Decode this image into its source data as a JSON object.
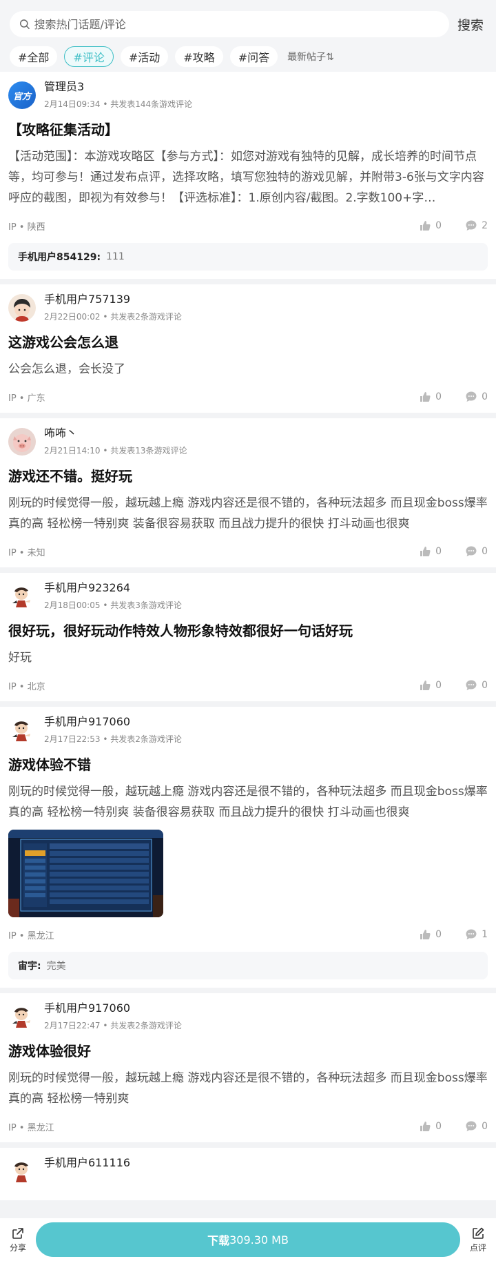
{
  "search": {
    "placeholder": "搜索热门话题/评论",
    "button_label": "搜索"
  },
  "filters": {
    "tags": [
      "#全部",
      "#评论",
      "#活动",
      "#攻略",
      "#问答"
    ],
    "active_index": 1,
    "sort_label": "最新帖子⇅"
  },
  "posts": [
    {
      "avatar": "官方",
      "username": "管理员3",
      "date": "2月14日09:34",
      "stats": "共发表144条游戏评论",
      "title": "【攻略征集活动】",
      "body": "【活动范围】：本游戏攻略区【参与方式】：如您对游戏有独特的见解，成长培养的时间节点等，均可参与！通过发布点评，选择攻略，填写您独特的游戏见解，并附带3-6张与文字内容呼应的截图，即视为有效参与！【评选标准】：1.原创内容/截图。2.字数100+字…",
      "ip": "IP • 陕西",
      "likes": "0",
      "comments": "2",
      "reply": {
        "user": "手机用户854129:",
        "text": "111"
      }
    },
    {
      "username": "手机用户757139",
      "date": "2月22日00:02",
      "stats": "共发表2条游戏评论",
      "title": "这游戏公会怎么退",
      "body": "公会怎么退，会长没了",
      "ip": "IP • 广东",
      "likes": "0",
      "comments": "0"
    },
    {
      "username": "咘咘丶",
      "date": "2月21日14:10",
      "stats": "共发表13条游戏评论",
      "title": "游戏还不错。挺好玩",
      "body": "刚玩的时候觉得一般，越玩越上瘾 游戏内容还是很不错的，各种玩法超多 而且现金boss爆率真的高 轻松榜一特别爽 装备很容易获取 而且战力提升的很快 打斗动画也很爽",
      "ip": "IP • 未知",
      "likes": "0",
      "comments": "0"
    },
    {
      "username": "手机用户923264",
      "date": "2月18日00:05",
      "stats": "共发表3条游戏评论",
      "title": "很好玩，很好玩动作特效人物形象特效都很好一句话好玩",
      "body": "好玩",
      "ip": "IP • 北京",
      "likes": "0",
      "comments": "0"
    },
    {
      "username": "手机用户917060",
      "date": "2月17日22:53",
      "stats": "共发表2条游戏评论",
      "title": "游戏体验不错",
      "body": "刚玩的时候觉得一般，越玩越上瘾 游戏内容还是很不错的，各种玩法超多 而且现金boss爆率真的高 轻松榜一特别爽 装备很容易获取 而且战力提升的很快 打斗动画也很爽",
      "ip": "IP • 黑龙江",
      "likes": "0",
      "comments": "1",
      "reply": {
        "user": "宙宇:",
        "text": "完美"
      }
    },
    {
      "username": "手机用户917060",
      "date": "2月17日22:47",
      "stats": "共发表2条游戏评论",
      "title": "游戏体验很好",
      "body": "刚玩的时候觉得一般，越玩越上瘾 游戏内容还是很不错的，各种玩法超多 而且现金boss爆率真的高 轻松榜一特别爽",
      "ip": "IP • 黑龙江",
      "likes": "0",
      "comments": "0"
    },
    {
      "username": "手机用户611116"
    }
  ],
  "bottom_bar": {
    "share_label": "分享",
    "download_label": "下载",
    "download_size": "309.30 MB",
    "review_label": "点评"
  },
  "colors": {
    "accent": "#3fbfc6",
    "download_bg": "#56c6cf",
    "page_bg": "#f2f3f5"
  }
}
